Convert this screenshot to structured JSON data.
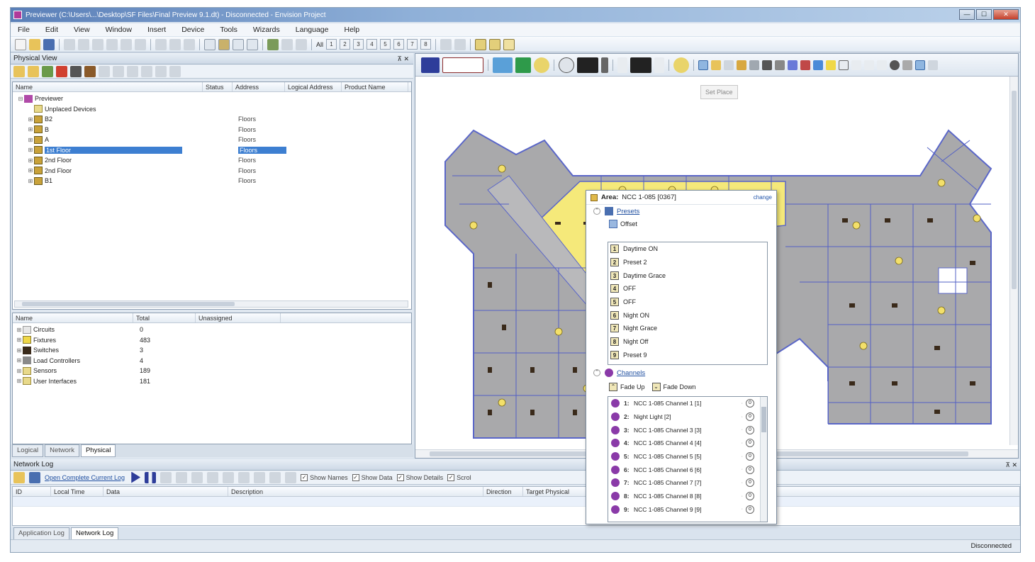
{
  "window": {
    "title": "Previewer (C:\\Users\\...\\Desktop\\SF Files\\Final Preview 9.1.dt) - Disconnected - Envision Project",
    "min_btn": "—",
    "max_btn": "☐",
    "close_btn": "✕"
  },
  "menu": [
    "File",
    "Edit",
    "View",
    "Window",
    "Insert",
    "Device",
    "Tools",
    "Wizards",
    "Language",
    "Help"
  ],
  "toolbar": {
    "all_label": "All",
    "numbers": [
      "1",
      "2",
      "3",
      "4",
      "5",
      "6",
      "7",
      "8"
    ]
  },
  "physical_view": {
    "title": "Physical View",
    "pin": "⊼ ✕",
    "columns": [
      "Name",
      "Status",
      "Address",
      "Logical Address",
      "Product Name"
    ],
    "root": "Previewer",
    "unplaced": "Unplaced Devices",
    "floors": [
      {
        "name": "B2",
        "address": "Floors"
      },
      {
        "name": "B",
        "address": "Floors"
      },
      {
        "name": "A",
        "address": "Floors"
      },
      {
        "name": "1st Floor",
        "address": "Floors",
        "selected": true
      },
      {
        "name": "2nd Floor",
        "address": "Floors"
      },
      {
        "name": "2nd Floor",
        "address": "Floors"
      },
      {
        "name": "B1",
        "address": "Floors"
      }
    ]
  },
  "summary": {
    "columns": [
      "Name",
      "Total",
      "Unassigned"
    ],
    "rows": [
      {
        "name": "Circuits",
        "total": "0",
        "unassigned": ""
      },
      {
        "name": "Fixtures",
        "total": "483",
        "unassigned": ""
      },
      {
        "name": "Switches",
        "total": "3",
        "unassigned": ""
      },
      {
        "name": "Load Controllers",
        "total": "4",
        "unassigned": ""
      },
      {
        "name": "Sensors",
        "total": "189",
        "unassigned": ""
      },
      {
        "name": "User Interfaces",
        "total": "181",
        "unassigned": ""
      }
    ]
  },
  "left_tabs": [
    "Logical",
    "Network",
    "Physical"
  ],
  "map": {
    "tooltip": "Set Place"
  },
  "area_popup": {
    "label": "Area:",
    "name": "NCC 1-085 [0367]",
    "change": "change",
    "presets_title": "Presets",
    "offset": "Offset",
    "presets": [
      {
        "num": "1",
        "name": "Daytime ON"
      },
      {
        "num": "2",
        "name": "Preset 2"
      },
      {
        "num": "3",
        "name": "Daytime Grace"
      },
      {
        "num": "4",
        "name": "OFF"
      },
      {
        "num": "5",
        "name": "OFF"
      },
      {
        "num": "6",
        "name": "Night ON"
      },
      {
        "num": "7",
        "name": "Night Grace"
      },
      {
        "num": "8",
        "name": "Night Off"
      },
      {
        "num": "9",
        "name": "Preset 9"
      }
    ],
    "channels_title": "Channels",
    "fade_up": "Fade Up",
    "fade_down": "Fade Down",
    "channels": [
      {
        "num": "1:",
        "name": "NCC 1-085 Channel 1 [1]"
      },
      {
        "num": "2:",
        "name": "Night Light [2]"
      },
      {
        "num": "3:",
        "name": "NCC 1-085 Channel 3 [3]"
      },
      {
        "num": "4:",
        "name": "NCC 1-085 Channel 4 [4]"
      },
      {
        "num": "5:",
        "name": "NCC 1-085 Channel 5 [5]"
      },
      {
        "num": "6:",
        "name": "NCC 1-085 Channel 6 [6]"
      },
      {
        "num": "7:",
        "name": "NCC 1-085 Channel 7 [7]"
      },
      {
        "num": "8:",
        "name": "NCC 1-085 Channel 8 [8]"
      },
      {
        "num": "9:",
        "name": "NCC 1-085 Channel 9 [9]"
      }
    ]
  },
  "network_log": {
    "title": "Network Log",
    "pin": "⊼ ✕",
    "open_link": "Open Complete Current Log",
    "show_names": "Show Names",
    "show_data": "Show Data",
    "show_details": "Show Details",
    "scroll": "Scrol",
    "columns": [
      "ID",
      "Local Time",
      "Data",
      "Description",
      "Direction",
      "Target Physical"
    ]
  },
  "bottom_tabs": [
    "Application Log",
    "Network Log"
  ],
  "status": "Disconnected",
  "colors": {
    "area_yellow": "#f5e97a",
    "room_gray": "#a8a8a8",
    "wall_blue": "#4a57c9",
    "channel_purple": "#8a3aa8",
    "selection_blue": "#3d7fd1"
  }
}
